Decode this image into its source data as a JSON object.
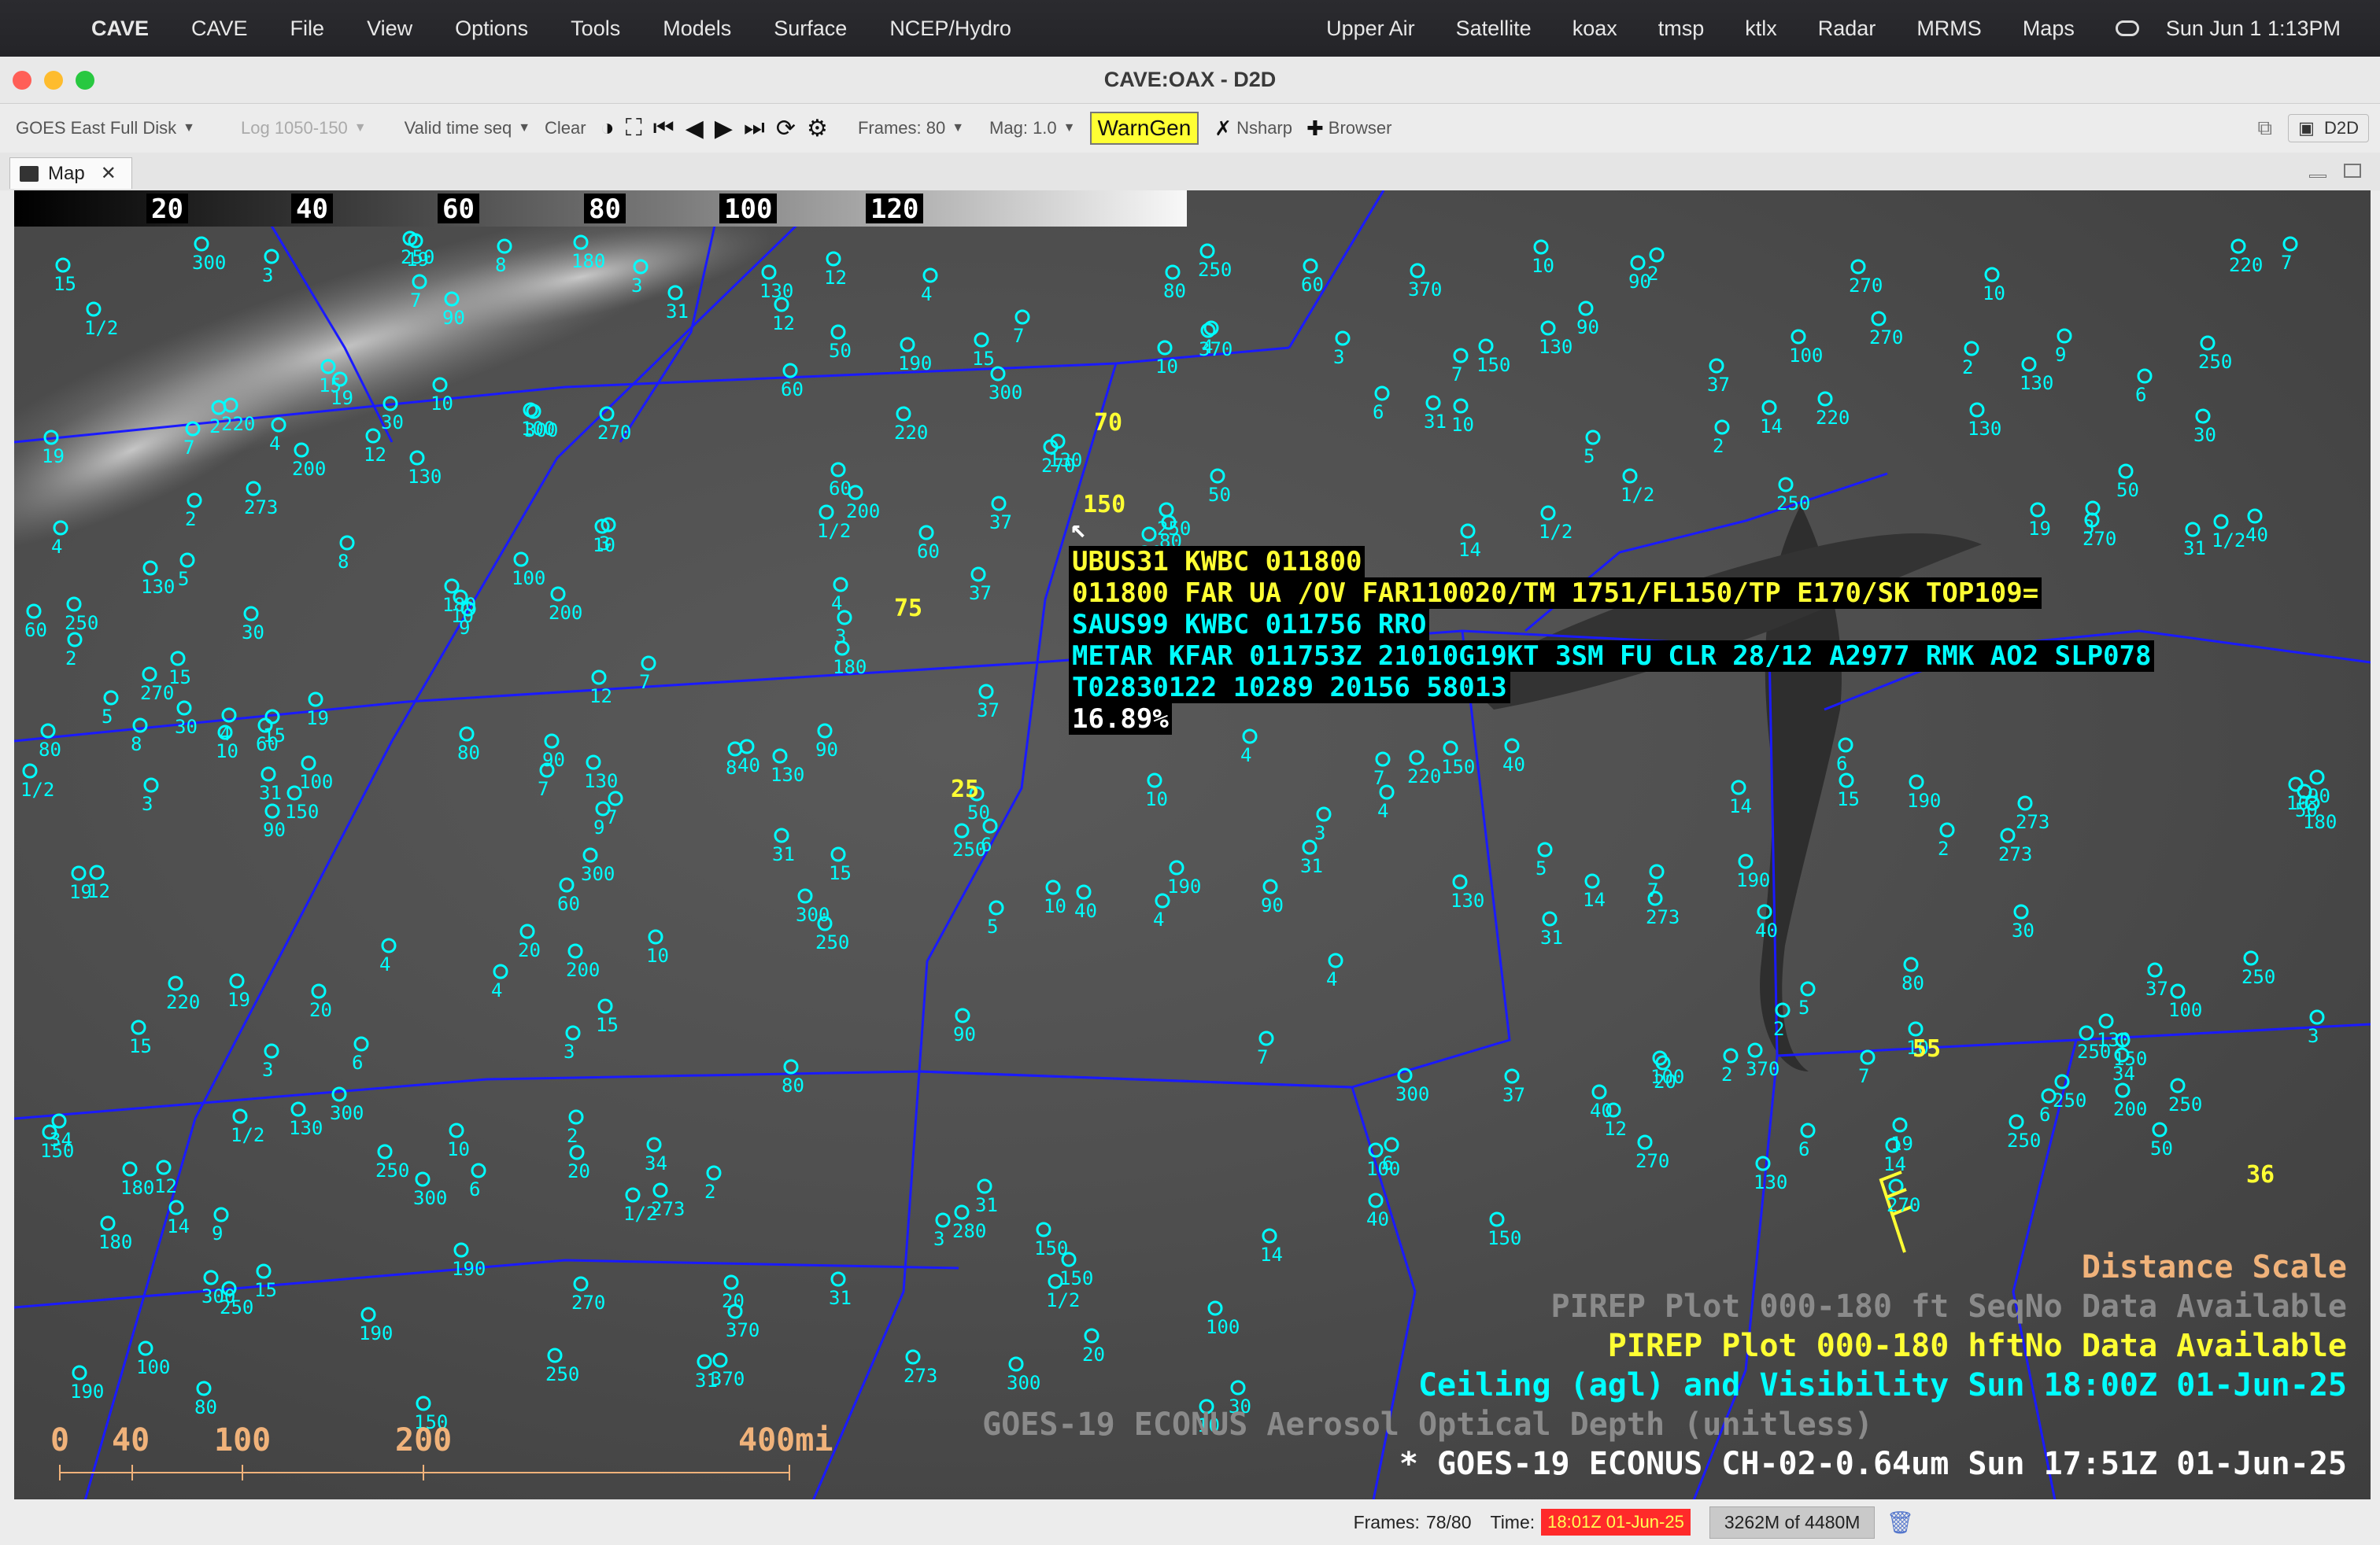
{
  "menubar": {
    "app": "CAVE",
    "items": [
      "CAVE",
      "File",
      "View",
      "Options",
      "Tools",
      "Models",
      "Surface",
      "NCEP/Hydro"
    ],
    "right_items": [
      "Upper Air",
      "Satellite",
      "koax",
      "tmsp",
      "ktlx",
      "Radar",
      "MRMS",
      "Maps"
    ],
    "clock": "Sun Jun 1  1:13PM"
  },
  "window": {
    "title": "CAVE:OAX - D2D"
  },
  "toolbar": {
    "projection": "GOES East Full Disk",
    "log": "Log 1050-150",
    "valid_time": "Valid time seq",
    "clear": "Clear",
    "frames": "Frames: 80",
    "mag": "Mag: 1.0",
    "warngen": "WarnGen",
    "nsharp": "Nsharp",
    "browser": "Browser",
    "d2d": "D2D"
  },
  "tab": {
    "label": "Map"
  },
  "colorbar": {
    "labels": [
      "20",
      "40",
      "60",
      "80",
      "100",
      "120"
    ]
  },
  "infobox": {
    "lines": [
      {
        "text": "UBUS31 KWBC 011800",
        "color": "#ffff33"
      },
      {
        "text": "011800 FAR UA /OV FAR110020/TM 1751/FL150/TP E170/SK TOP109=",
        "color": "#ffff33"
      },
      {
        "text": "SAUS99 KWBC 011756 RRO",
        "color": "#00ffff"
      },
      {
        "text": "METAR KFAR 011753Z 21010G19KT 3SM FU CLR 28/12 A2977 RMK AO2 SLP078",
        "color": "#00ffff"
      },
      {
        "text": "    T02830122 10289 20156 58013",
        "color": "#00ffff"
      },
      {
        "text": "16.89%",
        "color": "#ffffff"
      }
    ]
  },
  "pireps": [
    "70",
    "150",
    "75",
    "25",
    "55",
    "36"
  ],
  "legend": {
    "distance_scale": "Distance Scale",
    "pirep_dim": "PIREP Plot 000-180 ft SeqNo Data Available",
    "pirep": "PIREP Plot 000-180 hftNo Data Available",
    "ceiling": "Ceiling (agl) and Visibility   Sun 18:00Z 01-Jun-25",
    "aod": "GOES-19 ECONUS Aerosol Optical Depth (unitless)",
    "ch02": "* GOES-19 ECONUS CH-02-0.64um    Sun 17:51Z 01-Jun-25"
  },
  "scale": {
    "labels": [
      "0",
      "40",
      "100",
      "200",
      "400mi"
    ]
  },
  "station_values": [
    "10",
    "10",
    "9",
    "7",
    "4",
    "2",
    "3",
    "5",
    "15",
    "14",
    "12",
    "30",
    "60",
    "250",
    "220",
    "200",
    "280",
    "150",
    "270",
    "130",
    "190",
    "80",
    "300",
    "370",
    "250",
    "20",
    "8",
    "6",
    "1/2",
    "31",
    "37",
    "273",
    "19",
    "34",
    "90",
    "40",
    "50",
    "100",
    "180"
  ],
  "statusbar": {
    "frames_label": "Frames:",
    "frames": "78/80",
    "time_label": "Time:",
    "time": "18:01Z 01-Jun-25",
    "memory": "3262M of 4480M"
  },
  "colors": {
    "station": "#00ffff",
    "border": "#1a1aff",
    "pirep": "#ffff33",
    "scale": "#f0b27a"
  }
}
